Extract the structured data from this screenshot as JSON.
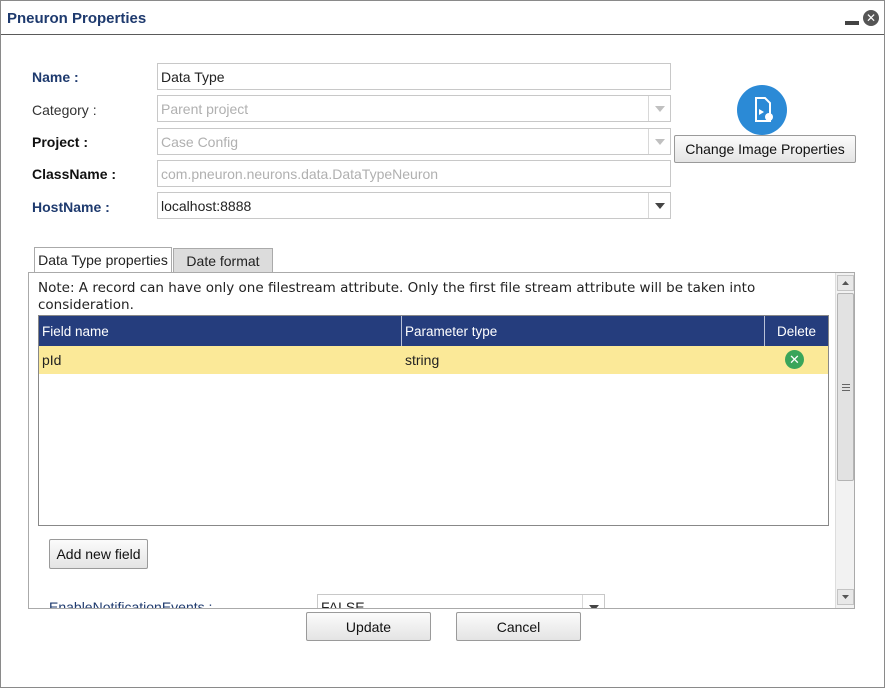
{
  "window": {
    "title": "Pneuron Properties"
  },
  "form": {
    "name_label": "Name :",
    "name_value": "Data Type",
    "category_label": "Category :",
    "category_value": "Parent project",
    "project_label": "Project :",
    "project_value": "Case Config",
    "classname_label": "ClassName :",
    "classname_value": "com.pneuron.neurons.data.DataTypeNeuron",
    "hostname_label": "HostName :",
    "hostname_value": "localhost:8888",
    "change_image_label": "Change Image Properties"
  },
  "tabs": [
    {
      "label": "Data Type properties",
      "active": true
    },
    {
      "label": "Date format",
      "active": false
    }
  ],
  "panel": {
    "note": "Note: A record can have only one filestream attribute. Only the first file stream attribute will be taken into consideration.",
    "grid": {
      "columns": [
        "Field name",
        "Parameter type",
        "Delete"
      ],
      "rows": [
        {
          "field_name": "pId",
          "parameter_type": "string",
          "selected": true
        }
      ]
    },
    "add_field_label": "Add new field",
    "notify_label": "EnableNotificationEvents :",
    "notify_value": "FALSE"
  },
  "footer": {
    "update_label": "Update",
    "cancel_label": "Cancel"
  },
  "colors": {
    "grid_header": "#253d7d",
    "row_highlight": "#fbe998",
    "label_blue": "#1e3a6e",
    "icon_blue": "#2b8ad6",
    "delete_green": "#3aa55a"
  },
  "icons": {
    "minimize": "minimize-icon",
    "close": "close-icon",
    "image": "image-properties-icon",
    "delete": "delete-row-icon"
  }
}
